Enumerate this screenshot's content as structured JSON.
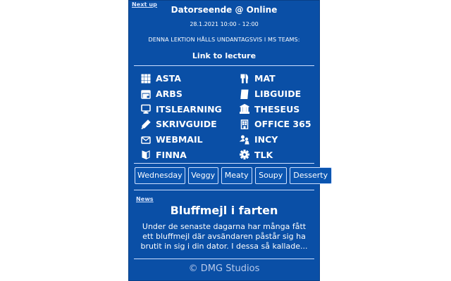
{
  "next_up": {
    "section_label": "Next up",
    "title": "Datorseende @ Online",
    "time": "28.1.2021 10:00 - 12:00",
    "note": "DENNA LEKTION HÅLLS UNDANTAGSVIS I MS TEAMS:",
    "link_label": "Link to lecture"
  },
  "links": [
    {
      "label": "ASTA",
      "icon": "utensils-grid-icon"
    },
    {
      "label": "MAT",
      "icon": "fork-knife-icon"
    },
    {
      "label": "ARBS",
      "icon": "calendar-icon"
    },
    {
      "label": "LIBGUIDE",
      "icon": "book-icon"
    },
    {
      "label": "ITSLEARNING",
      "icon": "monitor-icon"
    },
    {
      "label": "THESEUS",
      "icon": "university-icon"
    },
    {
      "label": "SKRIVGUIDE",
      "icon": "pencil-icon"
    },
    {
      "label": "OFFICE 365",
      "icon": "building-icon"
    },
    {
      "label": "WEBMAIL",
      "icon": "envelope-icon"
    },
    {
      "label": "INCY",
      "icon": "people-icon"
    },
    {
      "label": "FINNA",
      "icon": "book-open-icon"
    },
    {
      "label": "TLK",
      "icon": "gear-icon"
    }
  ],
  "menu_tabs": [
    "Wednesday",
    "Veggy",
    "Meaty",
    "Soupy",
    "Desserty"
  ],
  "news": {
    "section_label": "News",
    "headline": "Bluffmejl i farten",
    "excerpt": "Under de senaste dagarna har många fått ett bluffmejl där avsändaren påstår sig ha brutit in sig i din dator. I dessa så kallade..."
  },
  "footer": "© DMG Studios",
  "colors": {
    "panel_background": "#0a4fa6",
    "text": "#ffffff",
    "footer_text": "#b7c9ea"
  }
}
